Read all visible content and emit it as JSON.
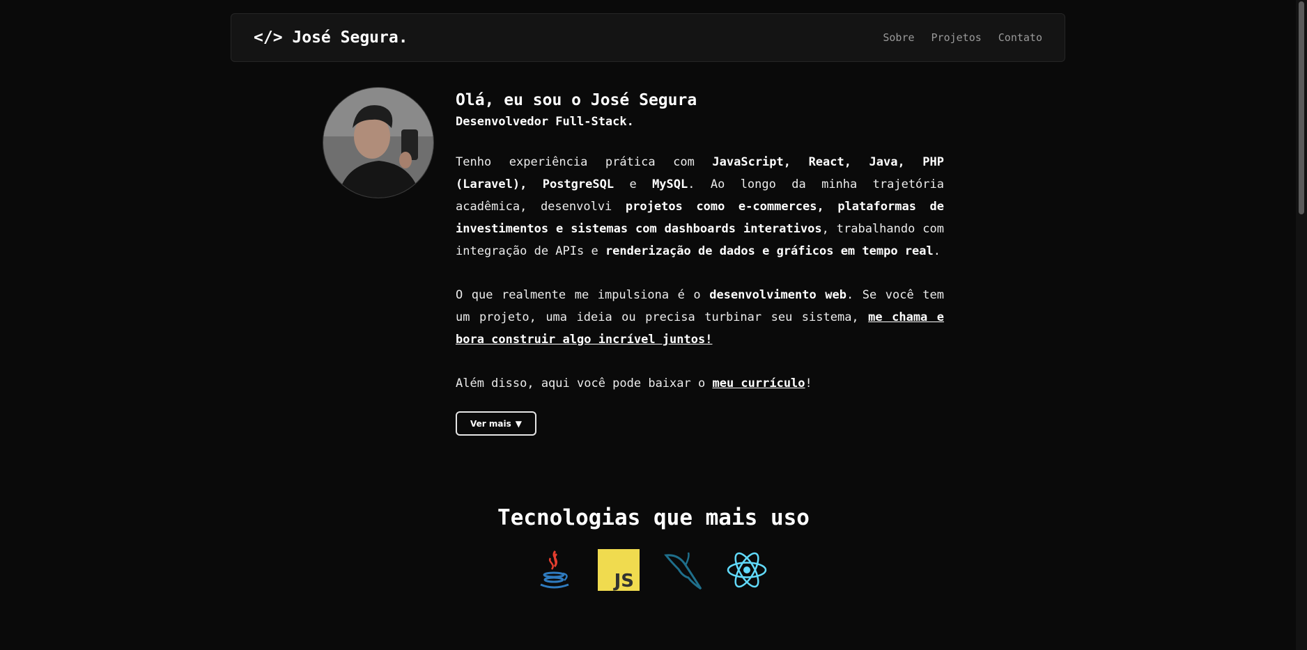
{
  "header": {
    "brand": "</> José Segura.",
    "nav": [
      "Sobre",
      "Projetos",
      "Contato"
    ]
  },
  "about": {
    "heading": "Olá, eu sou o José Segura",
    "subheading": "Desenvolvedor Full-Stack.",
    "p1": {
      "t1": "Tenho experiência prática com ",
      "b1": "JavaScript, React, Java, PHP (Laravel), PostgreSQL",
      "t2": " e ",
      "b2": "MySQL",
      "t3": ". Ao longo da minha trajetória acadêmica, desenvolvi ",
      "b3": "projetos como e-commerces, plataformas de investimentos e sistemas com dashboards interativos",
      "t4": ", trabalhando com integração de APIs e ",
      "b4": "renderização de dados e gráficos em tempo real",
      "t5": "."
    },
    "p2": {
      "t1": "O que realmente me impulsiona é o ",
      "b1": "desenvolvimento web",
      "t2": ". Se você tem um projeto, uma ideia ou precisa turbinar seu sistema, ",
      "link": "me chama e bora construir algo incrível juntos!"
    },
    "p3": {
      "t1": "Além disso, aqui você pode baixar o ",
      "link": "meu currículo",
      "t2": "!"
    },
    "more_button": "Ver mais",
    "more_button_arrow": "▼"
  },
  "technologies": {
    "title": "Tecnologias que mais uso",
    "icons": [
      "java-icon",
      "javascript-icon",
      "mysql-icon",
      "react-icon"
    ],
    "js_label": "JS"
  },
  "colors": {
    "background": "#0a0a0a",
    "navbar": "#141414",
    "nav_link": "#9a9a9a",
    "js_yellow": "#f0db4f",
    "react_cyan": "#61dafb",
    "mysql_blue": "#1f6f8b"
  }
}
